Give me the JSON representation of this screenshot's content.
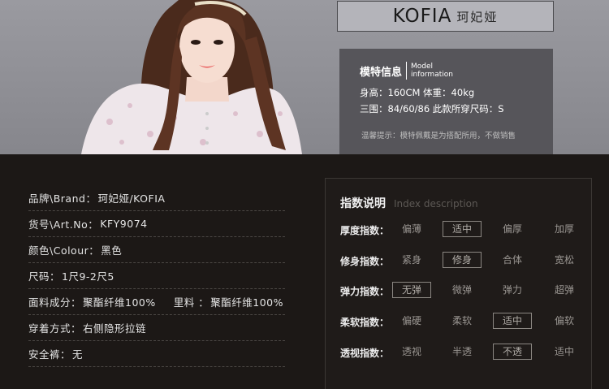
{
  "brand_logo": {
    "name_en": "KOFIA",
    "name_cn": "珂妃娅"
  },
  "model_info": {
    "title_cn": "模特信息",
    "title_en_line1": "Model",
    "title_en_line2": "information",
    "line1": "身高：160CM  体重：40kg",
    "line2": "三围：84/60/86   此款所穿尺码：S",
    "note": "温馨提示：模特佩戴是为搭配所用，不做销售"
  },
  "specs": [
    {
      "label": "品牌\\Brand：",
      "value": "珂妃娅/KOFIA"
    },
    {
      "label": "货号\\Art.No：",
      "value": "KFY9074"
    },
    {
      "label": "颜色\\Colour：",
      "value": "黑色"
    },
    {
      "label": "尺码：",
      "value": "1尺9-2尺5"
    },
    {
      "label": "面料成分：",
      "value": "聚酯纤维100%",
      "label2": "里料 ：",
      "value2": "聚酯纤维100%"
    },
    {
      "label": "穿着方式：",
      "value": "右侧隐形拉链"
    },
    {
      "label": "安全裤：",
      "value": "无"
    }
  ],
  "index_panel": {
    "title": "指数说明",
    "subtitle": "Index description",
    "rows": [
      {
        "label": "厚度指数：",
        "options": [
          "偏薄",
          "适中",
          "偏厚",
          "加厚"
        ],
        "selected": 1
      },
      {
        "label": "修身指数：",
        "options": [
          "紧身",
          "修身",
          "合体",
          "宽松"
        ],
        "selected": 1
      },
      {
        "label": "弹力指数：",
        "options": [
          "无弹",
          "微弹",
          "弹力",
          "超弹"
        ],
        "selected": 0
      },
      {
        "label": "柔软指数：",
        "options": [
          "偏硬",
          "柔软",
          "适中",
          "偏软"
        ],
        "selected": 2
      },
      {
        "label": "透视指数：",
        "options": [
          "透视",
          "半透",
          "不透",
          "适中"
        ],
        "selected": 2
      }
    ]
  }
}
